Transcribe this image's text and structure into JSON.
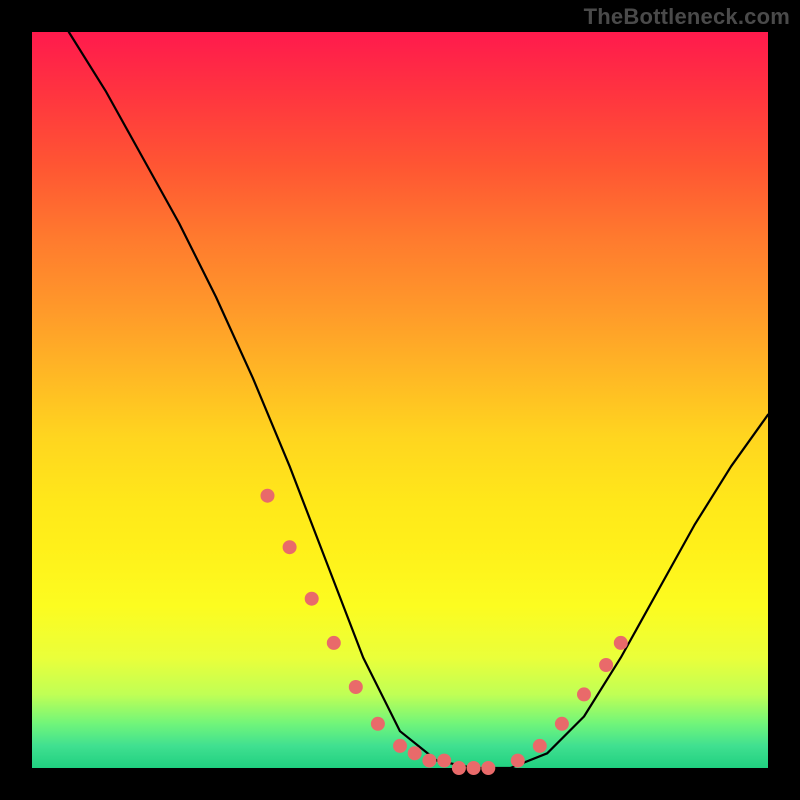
{
  "watermark": "TheBottleneck.com",
  "chart_data": {
    "type": "line",
    "title": "",
    "xlabel": "",
    "ylabel": "",
    "xlim": [
      0,
      100
    ],
    "ylim": [
      0,
      100
    ],
    "series": [
      {
        "name": "bottleneck-curve",
        "x": [
          5,
          10,
          15,
          20,
          25,
          30,
          35,
          40,
          45,
          50,
          55,
          60,
          65,
          70,
          75,
          80,
          85,
          90,
          95,
          100
        ],
        "values": [
          100,
          92,
          83,
          74,
          64,
          53,
          41,
          28,
          15,
          5,
          1,
          0,
          0,
          2,
          7,
          15,
          24,
          33,
          41,
          48
        ]
      }
    ],
    "markers": {
      "name": "highlight-dots",
      "color": "#e96a6a",
      "x": [
        32,
        35,
        38,
        41,
        44,
        47,
        50,
        52,
        54,
        56,
        58,
        60,
        62,
        66,
        69,
        72,
        75,
        78,
        80
      ],
      "values": [
        37,
        30,
        23,
        17,
        11,
        6,
        3,
        2,
        1,
        1,
        0,
        0,
        0,
        1,
        3,
        6,
        10,
        14,
        17
      ]
    },
    "background": "rainbow-vertical-gradient"
  }
}
